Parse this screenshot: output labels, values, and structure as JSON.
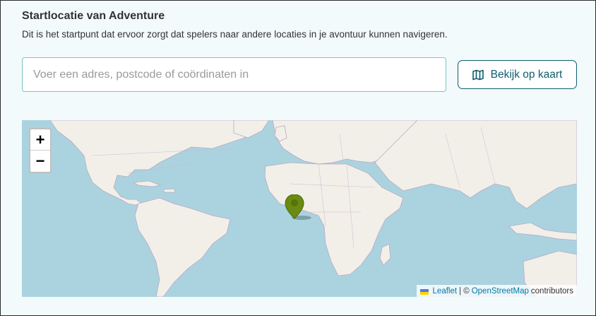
{
  "section": {
    "title": "Startlocatie van Adventure",
    "description": "Dit is het startpunt dat ervoor zorgt dat spelers naar andere locaties in je avontuur kunnen navigeren."
  },
  "search": {
    "value": "",
    "placeholder": "Voer een adres, postcode of coördinaten in"
  },
  "map_button": {
    "label": "Bekijk op kaart",
    "icon": "map-icon"
  },
  "map": {
    "zoom_in_label": "+",
    "zoom_out_label": "−",
    "marker_color": "#6a8a12",
    "attribution": {
      "leaflet_label": "Leaflet",
      "separator": "| ©",
      "osm_label": "OpenStreetMap",
      "suffix": "contributors"
    }
  },
  "colors": {
    "accent": "#0e5f6e",
    "input_border": "#7cc3c7",
    "water": "#aad3df",
    "land": "#f2efe9"
  }
}
